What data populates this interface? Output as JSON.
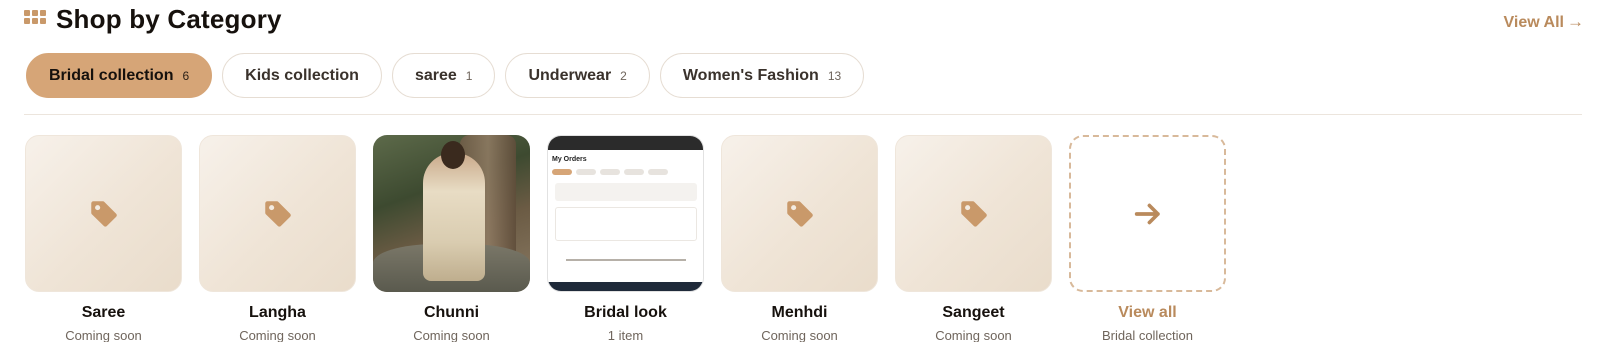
{
  "header": {
    "title": "Shop by Category",
    "view_all_label": "View All",
    "view_all_arrow": "→"
  },
  "tabs": [
    {
      "label": "Bridal collection",
      "count": "6",
      "active": true
    },
    {
      "label": "Kids collection",
      "count": "",
      "active": false
    },
    {
      "label": "saree",
      "count": "1",
      "active": false
    },
    {
      "label": "Underwear",
      "count": "2",
      "active": false
    },
    {
      "label": "Women's Fashion",
      "count": "13",
      "active": false
    }
  ],
  "cards": [
    {
      "name": "Saree",
      "sub": "Coming soon",
      "icon": "tag-icon"
    },
    {
      "name": "Langha",
      "sub": "Coming soon",
      "icon": "tag-icon"
    },
    {
      "name": "Chunni",
      "sub": "Coming soon",
      "icon": "photo"
    },
    {
      "name": "Bridal look",
      "sub": "1 item",
      "icon": "screenshot"
    },
    {
      "name": "Menhdi",
      "sub": "Coming soon",
      "icon": "tag-icon"
    },
    {
      "name": "Sangeet",
      "sub": "Coming soon",
      "icon": "tag-icon"
    }
  ],
  "view_all_card": {
    "name": "View all",
    "sub": "Bridal collection",
    "icon": "arrow-right-icon"
  },
  "screenshot_thumb": {
    "heading": "My Orders"
  },
  "colors": {
    "accent": "#d6a577",
    "link": "#b98a5c",
    "icon": "#c9996a"
  }
}
